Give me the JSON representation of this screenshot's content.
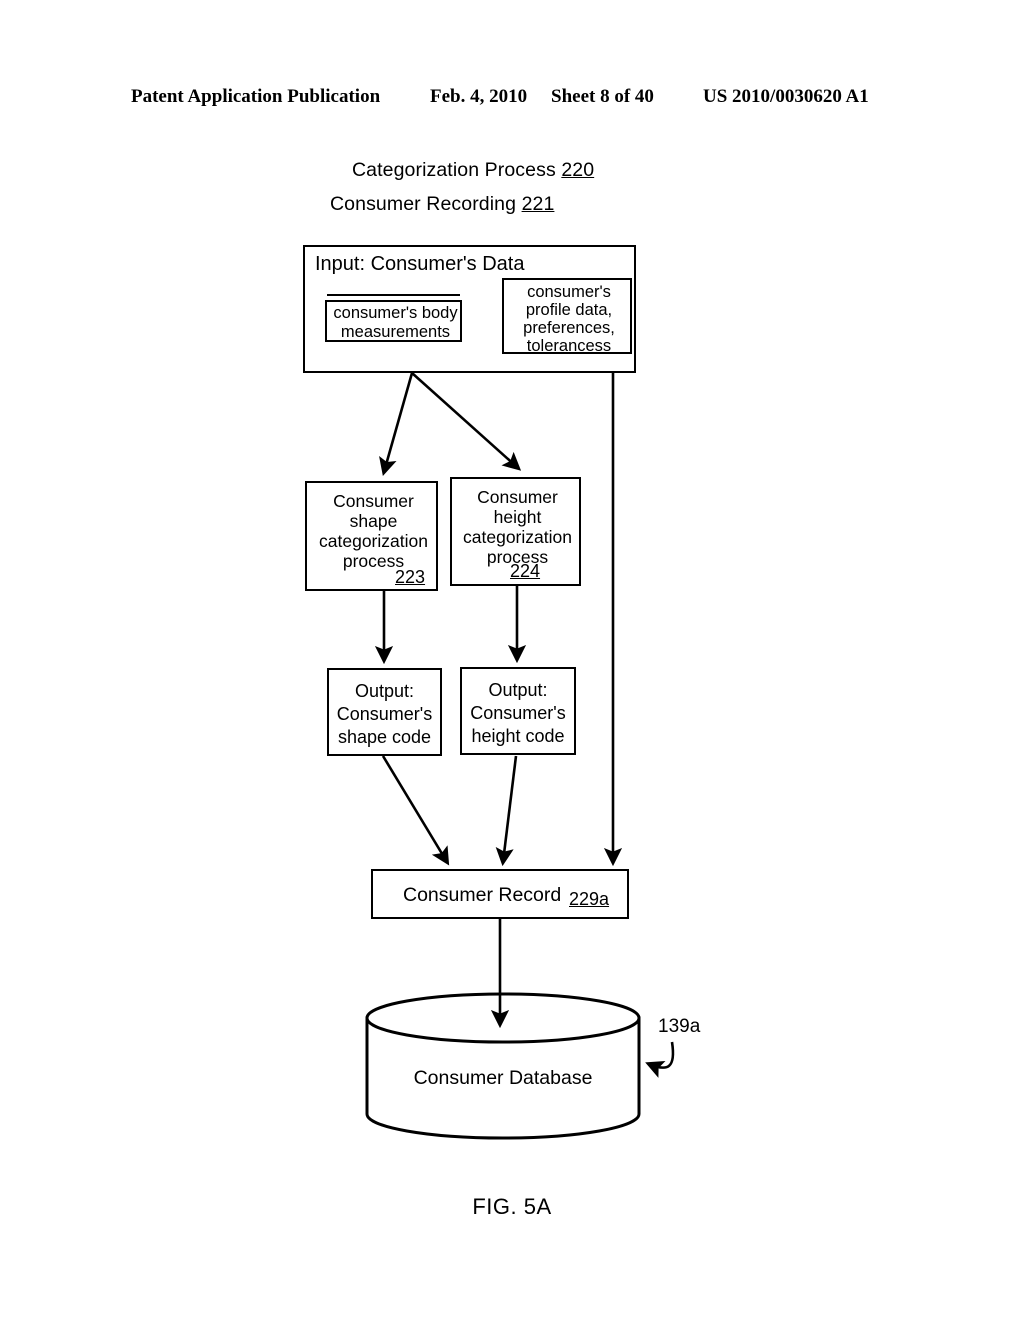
{
  "header": {
    "publication": "Patent Application Publication",
    "date": "Feb. 4, 2010",
    "sheet": "Sheet 8 of 40",
    "patent_number": "US 2010/0030620 A1"
  },
  "figure": {
    "caption": "FIG. 5A",
    "title_line1_text": "Categorization Process ",
    "title_line1_ref": "220",
    "title_line2_text": "Consumer Recording ",
    "title_line2_ref": "221"
  },
  "input": {
    "heading": "Input: Consumer's Data",
    "measurements_label": "consumer's body\nmeasurements",
    "profile_label": "consumer's\nprofile data,\npreferences,\ntolerancess"
  },
  "processes": {
    "shape": {
      "label": "Consumer\nshape\ncategorization\nprocess",
      "ref": "223"
    },
    "height": {
      "label": "Consumer\nheight\ncategorization\nprocess",
      "ref": "224"
    }
  },
  "outputs": {
    "shape": "Output:\nConsumer's\nshape code",
    "height": "Output:\nConsumer's\nheight code"
  },
  "record": {
    "label": "Consumer Record",
    "ref": "229a"
  },
  "database": {
    "label": "Consumer Database",
    "ref": "139a"
  },
  "colors": {
    "ink": "#000000",
    "paper": "#ffffff"
  }
}
